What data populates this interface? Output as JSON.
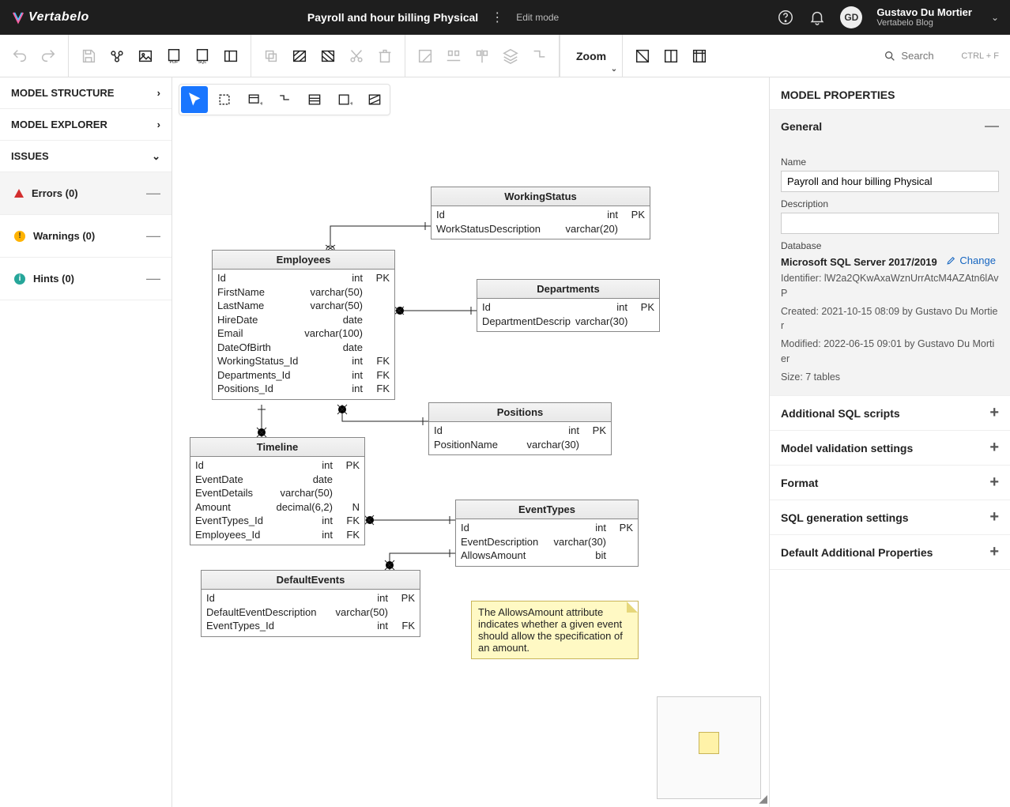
{
  "app": {
    "name": "Vertabelo"
  },
  "header": {
    "doc_title": "Payroll and hour billing Physical",
    "mode": "Edit mode",
    "user_initials": "GD",
    "user_name": "Gustavo Du Mortier",
    "user_sub": "Vertabelo Blog"
  },
  "toolbar": {
    "zoom_label": "Zoom",
    "search_placeholder": "Search",
    "search_hint": "CTRL + F"
  },
  "left": {
    "model_structure": "MODEL STRUCTURE",
    "model_explorer": "MODEL EXPLORER",
    "issues": "ISSUES",
    "errors": "Errors (0)",
    "warnings": "Warnings (0)",
    "hints": "Hints (0)"
  },
  "entities": {
    "employees": {
      "title": "Employees",
      "cols": [
        [
          "Id",
          "int",
          "PK"
        ],
        [
          "FirstName",
          "varchar(50)",
          ""
        ],
        [
          "LastName",
          "varchar(50)",
          ""
        ],
        [
          "HireDate",
          "date",
          ""
        ],
        [
          "Email",
          "varchar(100)",
          ""
        ],
        [
          "DateOfBirth",
          "date",
          ""
        ],
        [
          "WorkingStatus_Id",
          "int",
          "FK"
        ],
        [
          "Departments_Id",
          "int",
          "FK"
        ],
        [
          "Positions_Id",
          "int",
          "FK"
        ]
      ]
    },
    "workingstatus": {
      "title": "WorkingStatus",
      "cols": [
        [
          "Id",
          "int",
          "PK"
        ],
        [
          "WorkStatusDescription",
          "varchar(20)",
          ""
        ]
      ]
    },
    "departments": {
      "title": "Departments",
      "cols": [
        [
          "Id",
          "int",
          "PK"
        ],
        [
          "DepartmentDescrip",
          "varchar(30)",
          ""
        ]
      ]
    },
    "positions": {
      "title": "Positions",
      "cols": [
        [
          "Id",
          "int",
          "PK"
        ],
        [
          "PositionName",
          "varchar(30)",
          ""
        ]
      ]
    },
    "timeline": {
      "title": "Timeline",
      "cols": [
        [
          "Id",
          "int",
          "PK"
        ],
        [
          "EventDate",
          "date",
          ""
        ],
        [
          "EventDetails",
          "varchar(50)",
          ""
        ],
        [
          "Amount",
          "decimal(6,2)",
          "N"
        ],
        [
          "EventTypes_Id",
          "int",
          "FK"
        ],
        [
          "Employees_Id",
          "int",
          "FK"
        ]
      ]
    },
    "eventtypes": {
      "title": "EventTypes",
      "cols": [
        [
          "Id",
          "int",
          "PK"
        ],
        [
          "EventDescription",
          "varchar(30)",
          ""
        ],
        [
          "AllowsAmount",
          "bit",
          ""
        ]
      ]
    },
    "defaultevents": {
      "title": "DefaultEvents",
      "cols": [
        [
          "Id",
          "int",
          "PK"
        ],
        [
          "DefaultEventDescription",
          "varchar(50)",
          ""
        ],
        [
          "EventTypes_Id",
          "int",
          "FK"
        ]
      ]
    }
  },
  "note": "The AllowsAmount attribute indicates whether a given event should allow the specification of an amount.",
  "right": {
    "title": "MODEL PROPERTIES",
    "general": "General",
    "name_label": "Name",
    "name_value": "Payroll and hour billing Physical",
    "desc_label": "Description",
    "desc_value": "",
    "db_label": "Database",
    "db_value": "Microsoft SQL Server 2017/2019",
    "change": "Change",
    "identifier": "Identifier: lW2a2QKwAxaWznUrrAtcM4AZAtn6lAvP",
    "created": "Created: 2021-10-15 08:09 by Gustavo Du Mortier",
    "modified": "Modified: 2022-06-15 09:01 by Gustavo Du Mortier",
    "size": "Size: 7 tables",
    "sections": [
      "Additional SQL scripts",
      "Model validation settings",
      "Format",
      "SQL generation settings",
      "Default Additional Properties"
    ]
  }
}
